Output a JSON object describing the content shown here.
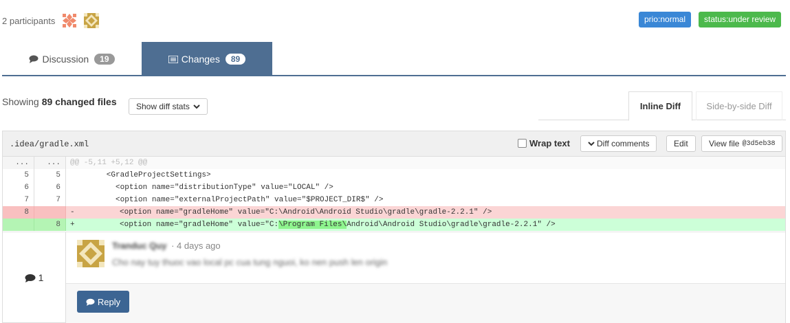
{
  "header": {
    "participants_label": "2 participants",
    "labels": [
      {
        "text": "prio:normal",
        "color": "#3a87d6"
      },
      {
        "text": "status:under review",
        "color": "#4cb94c"
      }
    ]
  },
  "tabs": [
    {
      "label": "Discussion",
      "count": "19",
      "icon": "comment-icon"
    },
    {
      "label": "Changes",
      "count": "89",
      "icon": "list-icon"
    }
  ],
  "toolbar": {
    "showing_prefix": "Showing",
    "changed_files": "89 changed files",
    "show_diff_stats": "Show diff stats"
  },
  "view_tabs": {
    "inline": "Inline Diff",
    "side_by_side": "Side-by-side Diff"
  },
  "file": {
    "path": ".idea/gradle.xml",
    "wrap_text": "Wrap text",
    "diff_comments": "Diff comments",
    "edit": "Edit",
    "view_file": "View file",
    "commit": "@3d5eb38"
  },
  "diff": [
    {
      "old": "...",
      "new": "...",
      "sign": "",
      "text": "@@ -5,11 +5,12 @@",
      "type": "hunk"
    },
    {
      "old": "5",
      "new": "5",
      "sign": "",
      "text": "        <GradleProjectSettings>",
      "type": "ctx"
    },
    {
      "old": "6",
      "new": "6",
      "sign": "",
      "text": "          <option name=\"distributionType\" value=\"LOCAL\" />",
      "type": "ctx"
    },
    {
      "old": "7",
      "new": "7",
      "sign": "",
      "text": "          <option name=\"externalProjectPath\" value=\"$PROJECT_DIR$\" />",
      "type": "ctx"
    },
    {
      "old": "8",
      "new": "",
      "sign": "-",
      "text": "          <option name=\"gradleHome\" value=\"C:\\Android\\Android Studio\\gradle\\gradle-2.2.1\" />",
      "type": "del"
    },
    {
      "old": "",
      "new": "8",
      "sign": "+",
      "pre": "          <option name=\"gradleHome\" value=\"C:",
      "highlight": "\\Program Files\\",
      "post": "Android\\Android Studio\\gradle\\gradle-2.2.1\" />",
      "type": "add"
    }
  ],
  "comment": {
    "count": "1",
    "author": "Tranduc Quy",
    "time": "· 4 days ago",
    "body": "Cho nay tuy thuoc vao local pc cua tung nguoi, ko nen push len origin",
    "reply": "Reply"
  },
  "colors": {
    "tab_active": "#4e6e92",
    "del_bg": "#fbd5d5",
    "del_num_bg": "#f9c0c0",
    "add_bg": "#ccffd8",
    "add_num_bg": "#b4f4b4",
    "reply_bg": "#3c6593"
  }
}
